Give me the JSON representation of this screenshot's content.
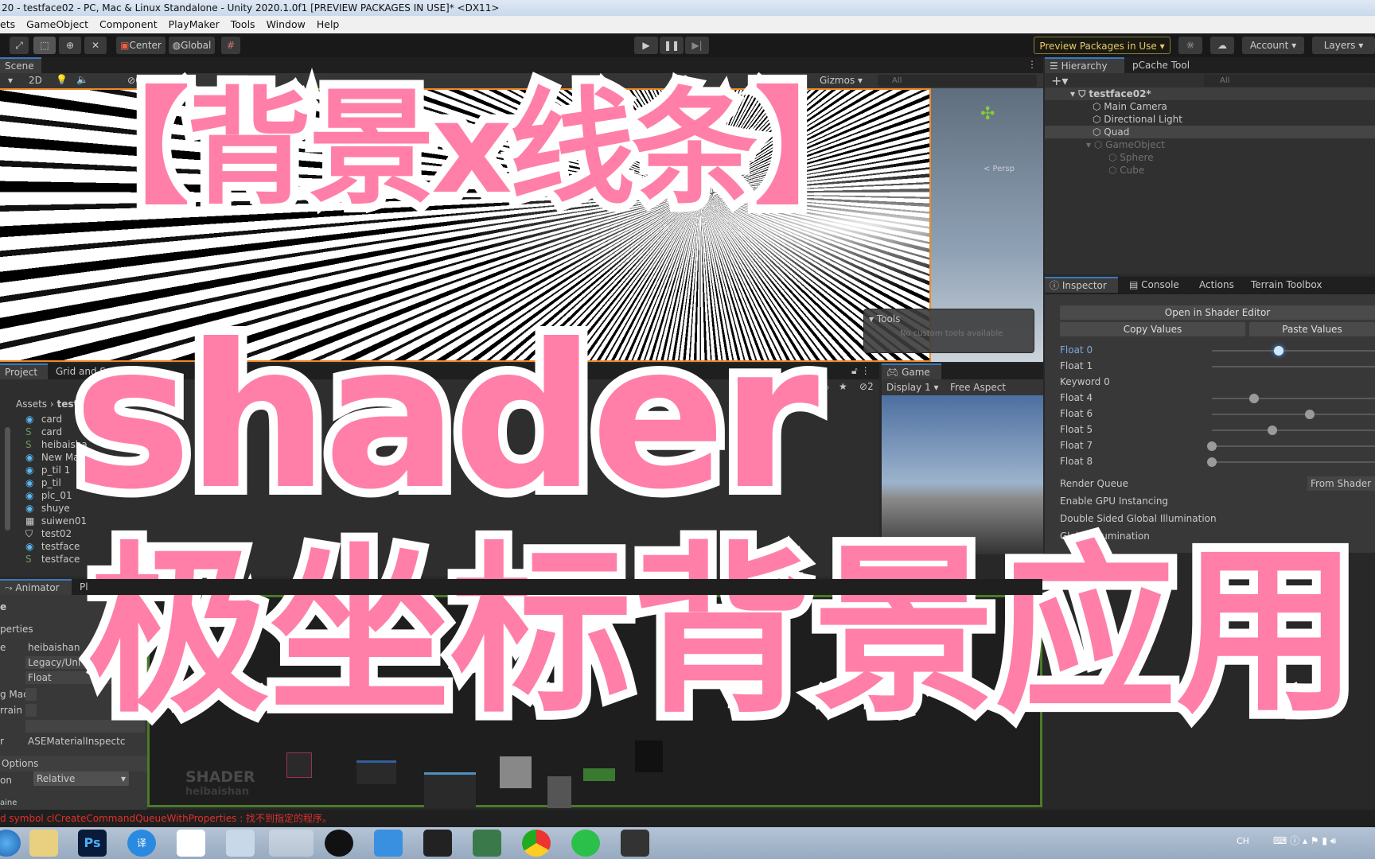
{
  "window": {
    "title": "20 - testface02 - PC, Mac & Linux Standalone - Unity 2020.1.0f1 [PREVIEW PACKAGES IN USE]* <DX11>"
  },
  "menu": [
    "ets",
    "GameObject",
    "Component",
    "PlayMaker",
    "Tools",
    "Window",
    "Help"
  ],
  "toolbar": {
    "center": "Center",
    "global": "Global",
    "preview_packages": "Preview Packages in Use",
    "account": "Account",
    "layers": "Layers"
  },
  "scene": {
    "tab": "Scene",
    "mode_2d": "2D",
    "hidden_count": "0",
    "gizmos": "Gizmos",
    "search_placeholder": "All",
    "persp": "< Persp",
    "tools_title": "Tools",
    "tools_empty": "No custom tools available"
  },
  "hierarchy": {
    "tabs": [
      "Hierarchy",
      "pCache Tool"
    ],
    "search_placeholder": "All",
    "scene": "testface02*",
    "items": [
      {
        "label": "Main Camera",
        "dim": false
      },
      {
        "label": "Directional Light",
        "dim": false
      },
      {
        "label": "Quad",
        "dim": false,
        "selected": true
      },
      {
        "label": "GameObject",
        "dim": true
      },
      {
        "label": "Sphere",
        "dim": true
      },
      {
        "label": "Cube",
        "dim": true
      }
    ]
  },
  "inspector": {
    "tabs": [
      "Inspector",
      "Console",
      "Actions",
      "Terrain Toolbox"
    ],
    "open_shader_editor": "Open in Shader Editor",
    "copy_values": "Copy Values",
    "paste_values": "Paste Values",
    "properties": [
      {
        "label": "Float 0",
        "slider": 0.41,
        "active": true
      },
      {
        "label": "Float 1",
        "slider": null
      },
      {
        "label": "Keyword 0"
      },
      {
        "label": "Float 4",
        "slider": 0.26
      },
      {
        "label": "Float 6",
        "slider": 0.6
      },
      {
        "label": "Float 5",
        "slider": 0.37
      },
      {
        "label": "Float 7",
        "slider": 0
      },
      {
        "label": "Float 8",
        "slider": 0
      }
    ],
    "render_queue": "Render Queue",
    "render_queue_value": "From Shader",
    "gpu_instancing": "Enable GPU Instancing",
    "double_sided_gi": "Double Sided Global Illumination",
    "global_illumination": "Global Illumination"
  },
  "project": {
    "tabs": [
      "Project",
      "Grid and S"
    ],
    "breadcrumb_root": "Assets",
    "breadcrumb_current": "test",
    "hidden_count": "2",
    "items": [
      {
        "label": "card",
        "icon": "material"
      },
      {
        "label": "card",
        "icon": "shader"
      },
      {
        "label": "heibaisha",
        "icon": "shader"
      },
      {
        "label": "New Mat",
        "icon": "material"
      },
      {
        "label": "p_til 1",
        "icon": "material"
      },
      {
        "label": "p_til",
        "icon": "material"
      },
      {
        "label": "plc_01",
        "icon": "material"
      },
      {
        "label": "shuye",
        "icon": "material"
      },
      {
        "label": "suiwen01",
        "icon": "texture"
      },
      {
        "label": "test02",
        "icon": "unity-scene"
      },
      {
        "label": "testface",
        "icon": "material"
      },
      {
        "label": "testface",
        "icon": "shader"
      }
    ]
  },
  "game": {
    "tab": "Game",
    "display": "Display 1",
    "aspect": "Free Aspect"
  },
  "bottom": {
    "tabs": [
      "Animator",
      "Pl"
    ],
    "header": "e",
    "properties_label": "perties",
    "fields": [
      {
        "label": "e",
        "value": "heibaishan"
      },
      {
        "label": "",
        "value": "Legacy/Unl"
      },
      {
        "label": "",
        "value": "Float"
      },
      {
        "label": "g Mac",
        "value": ""
      },
      {
        "label": "rrain",
        "value": ""
      },
      {
        "label": "",
        "value": ""
      },
      {
        "label": "r",
        "value": "ASEMaterialInspectc"
      }
    ],
    "options": "Options",
    "on_label": "on",
    "relative": "Relative",
    "cut_label": "aine"
  },
  "shader_graph": {
    "title": "SHADER",
    "name": "heibaishan"
  },
  "console": {
    "error": "d symbol clCreateCommandQueueWithProperties : 找不到指定的程序。"
  },
  "tray": {
    "lang": "CH"
  },
  "overlay": {
    "line1": "【背景x线条】",
    "line2": "shader",
    "line3": "极坐标背景应用"
  },
  "colors": {
    "accent_pink": "#ff7fa8",
    "selection_blue": "#3a79bb",
    "scene_border": "#f08a24",
    "error_red": "#e0302a"
  }
}
